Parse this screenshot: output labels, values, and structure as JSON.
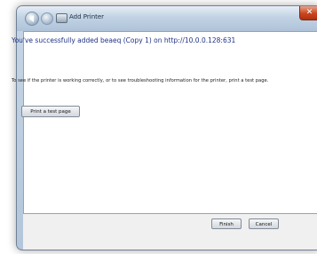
{
  "window": {
    "title": "Add Printer",
    "close_symbol": "✕"
  },
  "page": {
    "heading": "You've successfully added beaeq (Copy 1) on http://10.0.0.128:631",
    "instruction": "To see if the printer is working correctly, or to see troubleshooting information for the printer, print a test page."
  },
  "buttons": {
    "test_page": "Print a test page",
    "finish": "Finish",
    "cancel": "Cancel"
  },
  "icons": {
    "back": "back-arrow-icon",
    "forward": "forward-arrow-icon",
    "printer": "printer-icon",
    "close": "close-icon"
  },
  "colors": {
    "heading": "#1e3287",
    "titlebar": "#c1d2e4",
    "close": "#c9461f"
  }
}
